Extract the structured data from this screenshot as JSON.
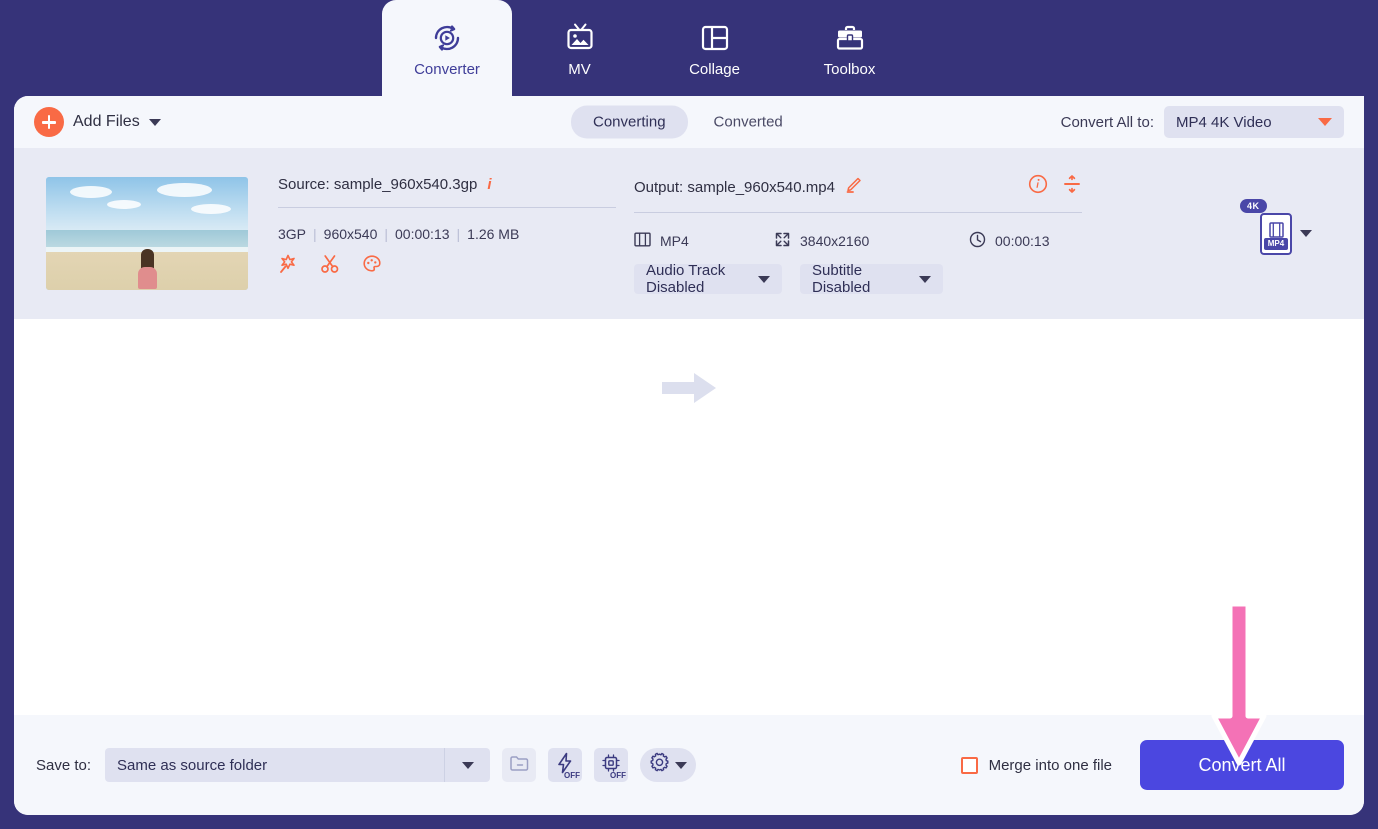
{
  "nav": {
    "tabs": [
      {
        "label": "Converter",
        "icon": "converter-icon",
        "active": true
      },
      {
        "label": "MV",
        "icon": "mv-icon",
        "active": false
      },
      {
        "label": "Collage",
        "icon": "collage-icon",
        "active": false
      },
      {
        "label": "Toolbox",
        "icon": "toolbox-icon",
        "active": false
      }
    ]
  },
  "toolbar": {
    "add_files_label": "Add Files",
    "add_files_icon": "plus-circle-icon",
    "add_files_caret": "chevron-down-icon",
    "segments": [
      {
        "label": "Converting",
        "active": true
      },
      {
        "label": "Converted",
        "active": false
      }
    ],
    "convert_all_to_label": "Convert All to:",
    "convert_all_to_value": "MP4 4K Video",
    "convert_all_to_caret": "chevron-down-icon"
  },
  "file_item": {
    "thumbnail_alt": "beach-thumbnail",
    "source": {
      "title": "Source: sample_960x540.3gp",
      "info_icon": "info-italic-icon",
      "format": "3GP",
      "resolution": "960x540",
      "duration": "00:00:13",
      "size": "1.26 MB",
      "separator": "|",
      "edit_icons": [
        {
          "name": "magic-wand-icon"
        },
        {
          "name": "scissors-trim-icon"
        },
        {
          "name": "palette-effects-icon"
        }
      ]
    },
    "transfer_arrow_icon": "right-arrow-icon",
    "output": {
      "title": "Output: sample_960x540.mp4",
      "edit_icon": "pencil-edit-icon",
      "info_icon": "info-circle-icon",
      "compress_icon": "compress-icon",
      "format": "MP4",
      "format_icon": "film-strip-icon",
      "resolution": "3840x2160",
      "resolution_icon": "expand-icon",
      "duration": "00:00:13",
      "duration_icon": "clock-icon",
      "audio_track": "Audio Track Disabled",
      "subtitle": "Subtitle Disabled",
      "caret": "chevron-down-icon"
    },
    "format_badge": {
      "quality": "4K",
      "format": "MP4",
      "caret": "chevron-down-icon"
    }
  },
  "bottom": {
    "save_to_label": "Save to:",
    "save_to_value": "Same as source folder",
    "save_to_caret": "chevron-down-icon",
    "buttons": [
      {
        "name": "open-folder-icon",
        "badge": ""
      },
      {
        "name": "lightning-speed-icon",
        "badge": "OFF"
      },
      {
        "name": "gpu-chip-icon",
        "badge": "OFF"
      },
      {
        "name": "gear-settings-icon",
        "badge": ""
      }
    ],
    "merge_label": "Merge into one file",
    "merge_checked": false,
    "convert_all_label": "Convert All"
  },
  "annotation": {
    "arrow": "down-arrow-annotation",
    "color": "#f472b6"
  },
  "colors": {
    "header_bg": "#363379",
    "accent_orange": "#f96a45",
    "accent_indigo": "#4b47e0",
    "panel_bg": "#e8eaf4",
    "toolbar_bg": "#f5f7fc",
    "control_bg": "#dfe1f0",
    "badge_purple": "#4a47a8"
  }
}
